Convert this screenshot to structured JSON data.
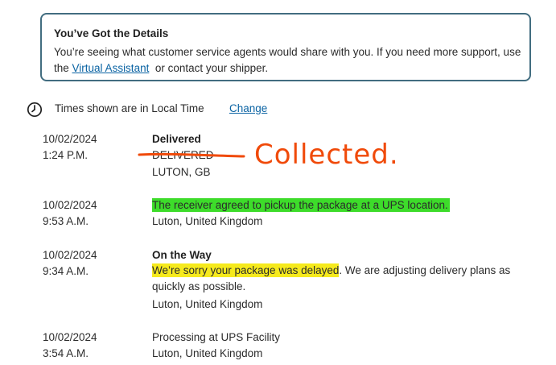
{
  "details": {
    "title": "You’ve Got the Details",
    "body_prefix": "You’re seeing what customer service agents would share with you. If you need more support, use the ",
    "link": "Virtual Assistant",
    "body_suffix": "  or contact your shipper."
  },
  "time_notice": {
    "icon": "clock-icon",
    "label": "Times shown are in Local Time",
    "change_link": "Change"
  },
  "events": [
    {
      "date": "10/02/2024",
      "time": "1:24 P.M.",
      "status": "Delivered",
      "detail": "DELIVERED",
      "location": "LUTON, GB"
    },
    {
      "date": "10/02/2024",
      "time": "9:53 A.M.",
      "detail": "The receiver agreed to pickup the package at a UPS location.",
      "location": "Luton, United Kingdom"
    },
    {
      "date": "10/02/2024",
      "time": "9:34 A.M.",
      "status": "On the Way",
      "detail_highlighted": "We’re sorry your package was delayed",
      "detail_rest": ". We are adjusting delivery plans as quickly as possible.",
      "location": "Luton, United Kingdom"
    },
    {
      "date": "10/02/2024",
      "time": "3:54 A.M.",
      "detail": "Processing at UPS Facility",
      "location": "Luton, United Kingdom"
    }
  ],
  "annotation": {
    "text": "Collected.",
    "color": "#f04a0a"
  },
  "colors": {
    "box_border": "#426d80",
    "link": "#0a63a3",
    "highlight_green": "#3ddc2a",
    "highlight_yellow": "#f6ea1d"
  }
}
